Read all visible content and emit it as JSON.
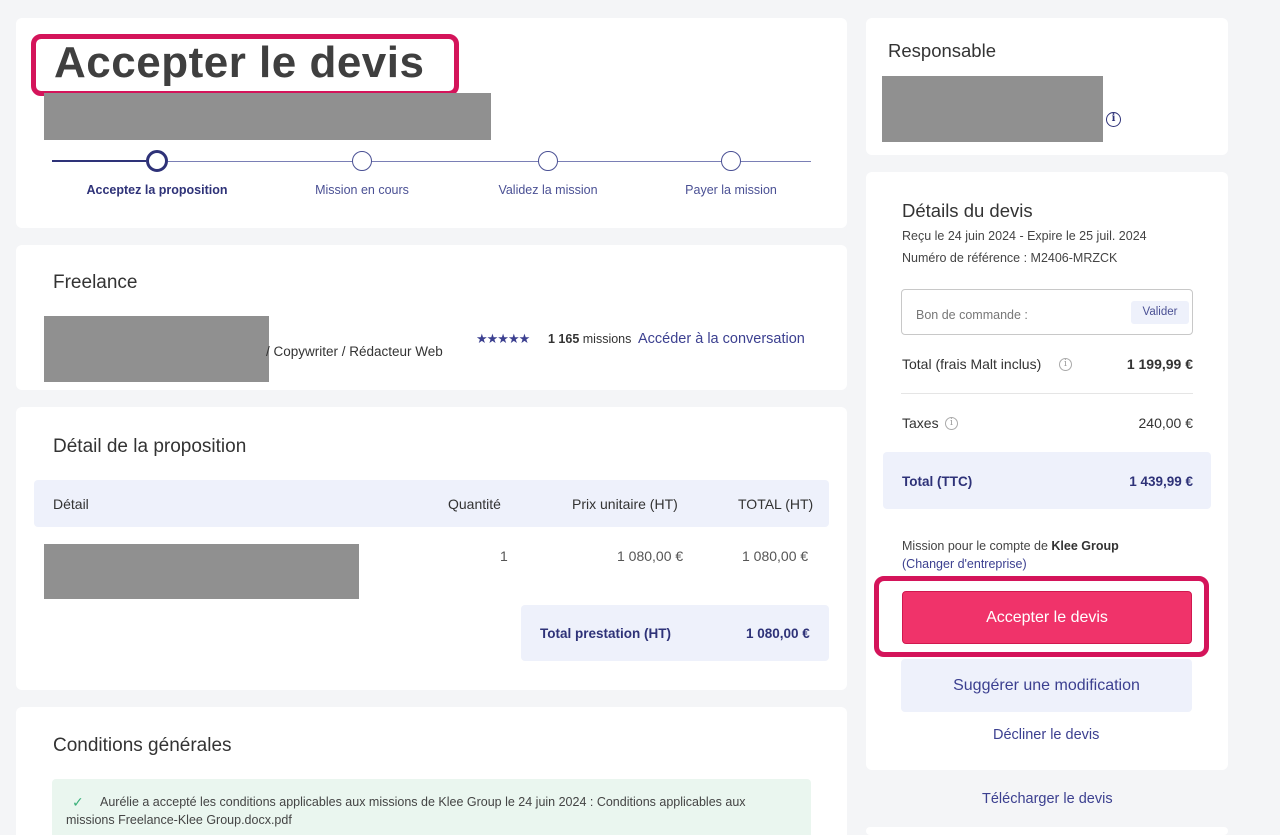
{
  "header": {
    "title": "Accepter le devis",
    "steps": [
      {
        "label": "Acceptez la proposition",
        "active": true
      },
      {
        "label": "Mission en cours",
        "active": false
      },
      {
        "label": "Validez la mission",
        "active": false
      },
      {
        "label": "Payer la mission",
        "active": false
      }
    ]
  },
  "freelance": {
    "heading": "Freelance",
    "role": "/ Copywriter / Rédacteur Web",
    "stars": "★★★★★",
    "rating": 5,
    "missions_count": "1 165",
    "missions_label": "missions",
    "conversation_link": "Accéder à la conversation"
  },
  "proposition": {
    "heading": "Détail de la proposition",
    "columns": [
      "Détail",
      "Quantité",
      "Prix unitaire (HT)",
      "TOTAL (HT)"
    ],
    "rows": [
      {
        "quantity": "1",
        "unit_price": "1 080,00 €",
        "total": "1 080,00 €"
      }
    ],
    "total_label": "Total prestation (HT)",
    "total_value": "1 080,00 €"
  },
  "conditions": {
    "heading": "Conditions générales",
    "check_icon": "check-icon",
    "text": "Aurélie a accepté les conditions applicables aux missions de Klee Group le 24 juin 2024 : Conditions applicables aux missions Freelance-Klee Group.docx.pdf"
  },
  "responsable": {
    "heading": "Responsable",
    "info_icon": "info-icon"
  },
  "quote": {
    "heading": "Détails du devis",
    "dates": "Reçu le 24 juin 2024 - Expire le 25 juil. 2024",
    "reference": "Numéro de référence : M2406-MRZCK",
    "po_placeholder": "Bon de commande :",
    "po_button": "Valider",
    "total_label": "Total (frais Malt inclus)",
    "total_value": "1 199,99 €",
    "taxes_label": "Taxes",
    "taxes_value": "240,00 €",
    "ttc_label": "Total (TTC)",
    "ttc_value": "1 439,99 €",
    "account_prefix": "Mission pour le compte de",
    "account_name": "Klee Group",
    "change_company": "(Changer d'entreprise)",
    "accept_button": "Accepter le devis",
    "suggest_button": "Suggérer une modification",
    "decline_link": "Décliner le devis",
    "download_link": "Télécharger le devis"
  },
  "colors": {
    "accent": "#f0336a",
    "highlight": "#d4145a",
    "navy": "#2e3278",
    "light_bg": "#eef1fb"
  }
}
